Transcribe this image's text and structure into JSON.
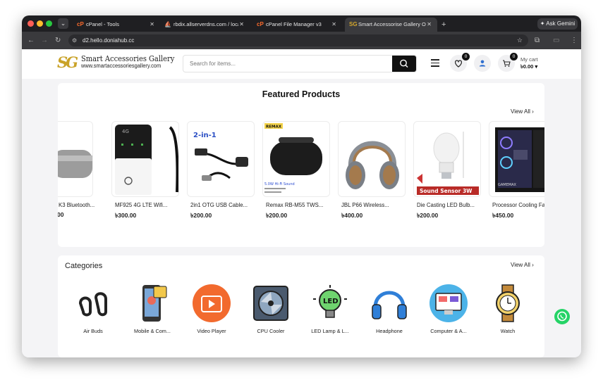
{
  "browser": {
    "tabs": [
      {
        "title": "cPanel - Tools",
        "favicon": "cpanel-icon",
        "active": false
      },
      {
        "title": "rbdix.allserverdns.com / local",
        "favicon": "phpmyadmin-icon",
        "active": false
      },
      {
        "title": "cPanel File Manager v3",
        "favicon": "cpanel-icon",
        "active": false
      },
      {
        "title": "Smart Accessorise Gallery On",
        "favicon": "sg-logo-icon",
        "active": true
      }
    ],
    "gemini_label": "Ask Gemini",
    "url": "d2.hello.doniahub.cc"
  },
  "site": {
    "logo_mark": "SG",
    "logo_name": "Smart Accessories Gallery",
    "logo_url": "www.smartaccessoriesgallery.com",
    "search_placeholder": "Search for items...",
    "wishlist_count": "0",
    "cart_count": "0",
    "cart_label": "My cart",
    "cart_amount": "৳0.00",
    "cart_caret": "▾"
  },
  "featured": {
    "title": "Featured Products",
    "view_all": "View All",
    "products": [
      {
        "name": "K3 Bluetooth...",
        "price": "00"
      },
      {
        "name": "MF925 4G LTE Wifi...",
        "price": "৳300.00"
      },
      {
        "name": "2in1 OTG USB Cable...",
        "price": "৳200.00"
      },
      {
        "name": "Remax RB-M55 TWS...",
        "price": "৳200.00"
      },
      {
        "name": "JBL P66 Wireless...",
        "price": "৳400.00"
      },
      {
        "name": "Die Casting LED Bulb...",
        "price": "৳200.00"
      },
      {
        "name": "Processor Cooling Fa",
        "price": "৳450.00"
      }
    ],
    "image_text": {
      "router_brand": "4G",
      "otg_badge": "2-in-1",
      "remax_brand": "REMAX",
      "remax_caption": "5.0W Hi-Fi Sound",
      "bulb_banner": "Sound Sensor 3W",
      "case_brand": "GAMEMAX"
    }
  },
  "categories": {
    "title": "Categories",
    "view_all": "View All",
    "items": [
      {
        "label": "Air Buds",
        "icon": "earbuds-icon"
      },
      {
        "label": "Mobile & Com...",
        "icon": "mobile-icon"
      },
      {
        "label": "Video Player",
        "icon": "video-player-icon"
      },
      {
        "label": "CPU Cooler",
        "icon": "cpu-cooler-icon"
      },
      {
        "label": "LED Lamp & L...",
        "icon": "led-lamp-icon"
      },
      {
        "label": "Headphone",
        "icon": "headphone-icon"
      },
      {
        "label": "Computer & A...",
        "icon": "computer-icon"
      },
      {
        "label": "Watch",
        "icon": "watch-icon"
      }
    ],
    "led_text": "LED"
  },
  "colors": {
    "accent_black": "#111111",
    "whatsapp": "#25d366",
    "logo_gold": "#c9a227"
  }
}
